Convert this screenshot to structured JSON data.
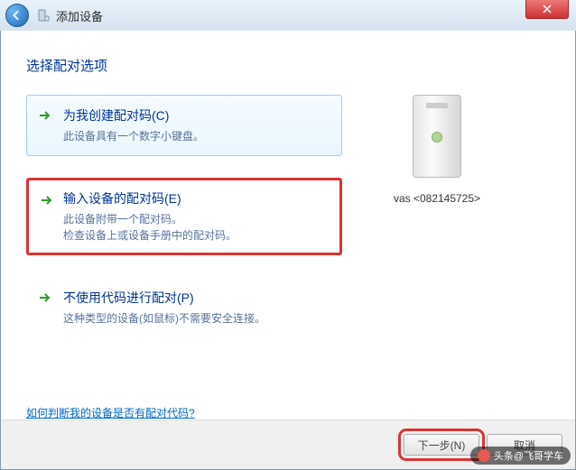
{
  "titlebar": {
    "title": "添加设备"
  },
  "heading": "选择配对选项",
  "options": [
    {
      "title": "为我创建配对码(C)",
      "desc": "此设备具有一个数字小键盘。"
    },
    {
      "title": "输入设备的配对码(E)",
      "desc1": "此设备附带一个配对码。",
      "desc2": "检查设备上或设备手册中的配对码。"
    },
    {
      "title": "不使用代码进行配对(P)",
      "desc": "这种类型的设备(如鼠标)不需要安全连接。"
    }
  ],
  "device": {
    "label": "vas <082145725>"
  },
  "helpLink": "如何判断我的设备是否有配对代码?",
  "footer": {
    "next": "下一步(N)",
    "cancel": "取消"
  },
  "watermark": "头条@飞哥学车"
}
